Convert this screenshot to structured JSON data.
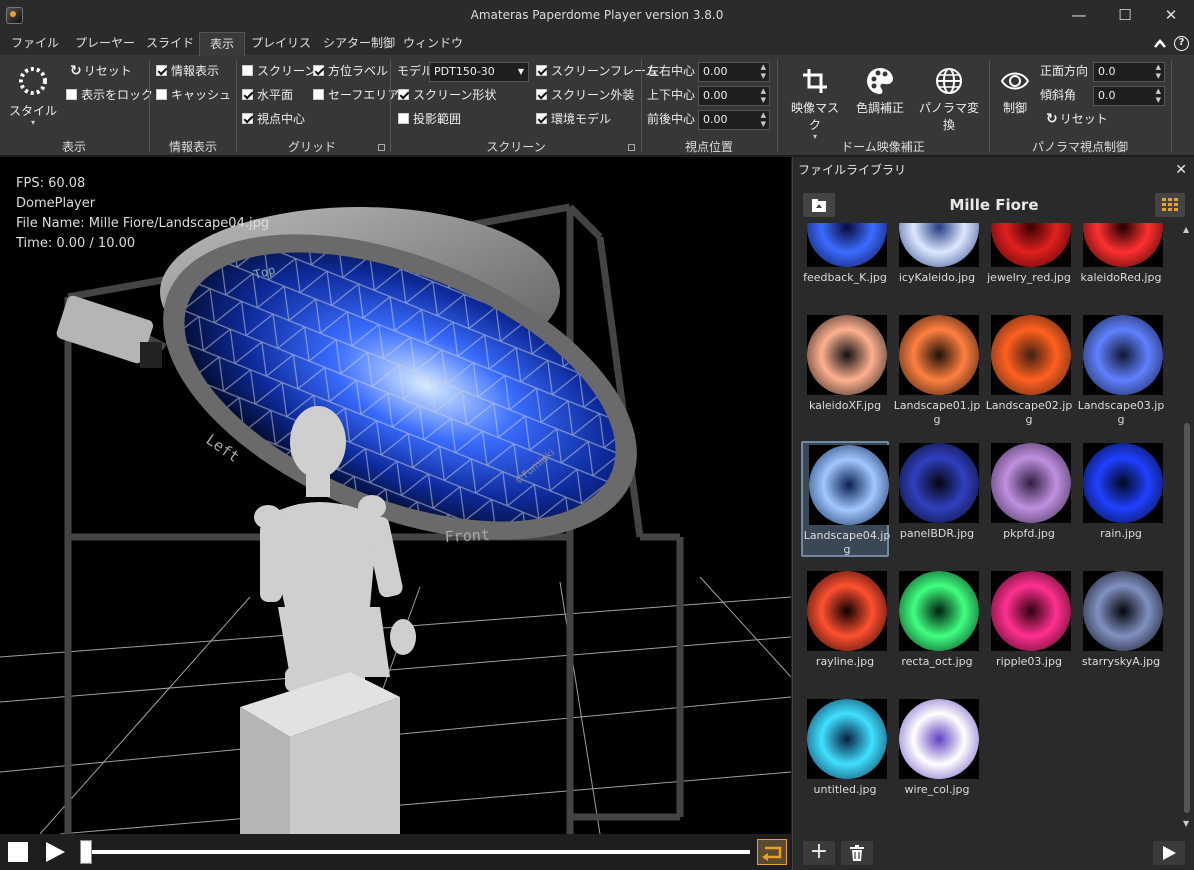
{
  "window": {
    "title": "Amateras Paperdome Player version 3.8.0",
    "minimize": "—",
    "maximize": "☐",
    "close": "✕"
  },
  "menu": {
    "tabs": [
      "ファイル",
      "プレーヤー",
      "スライド",
      "表示",
      "プレイリスト",
      "シアター制御",
      "ウィンドウ"
    ],
    "active": "表示",
    "collapse_icon": "chevron-up-icon",
    "help": "?"
  },
  "ribbon": {
    "display": {
      "style_label": "スタイル",
      "reset": "リセット",
      "lock": "表示をロック",
      "group": "表示"
    },
    "info": {
      "show_info": "情報表示",
      "cache": "キャッシュ",
      "group": "情報表示"
    },
    "grid": {
      "screen": "スクリーン",
      "horizon": "水平面",
      "view_center": "視点中心",
      "azimuth_label": "方位ラベル",
      "safe_area": "セーフエリア",
      "group": "グリッド"
    },
    "screen": {
      "model_label": "モデル",
      "model_value": "PDT150-30",
      "screen_shape": "スクリーン形状",
      "projection_range": "投影範囲",
      "screen_frame": "スクリーンフレーム",
      "screen_exterior": "スクリーン外装",
      "env_model": "環境モデル",
      "group": "スクリーン"
    },
    "viewpoint": {
      "lr_label": "左右中心",
      "lr_value": "0.00",
      "ud_label": "上下中心",
      "ud_value": "0.00",
      "fb_label": "前後中心",
      "fb_value": "0.00",
      "group": "視点位置"
    },
    "dome": {
      "mask": "映像マスク",
      "color": "色調補正",
      "panorama": "パノラマ変換",
      "group": "ドーム映像補正"
    },
    "pano": {
      "control": "制御",
      "front_label": "正面方向",
      "front_value": "0.0",
      "tilt_label": "傾斜角",
      "tilt_value": "0.0",
      "reset": "リセット",
      "group": "パノラマ視点制御"
    }
  },
  "viewport": {
    "fps": "FPS: 60.08",
    "player": "DomePlayer",
    "file": "File Name: Mille Fiore/Landscape04.jpg",
    "time": "Time: 0.00 / 10.00",
    "labels": {
      "left": "Left",
      "front": "Front",
      "top": "Top",
      "watermark": "©Fumiaki"
    }
  },
  "transport": {
    "progress": 0
  },
  "library": {
    "title": "ファイルライブラリ",
    "folder": "Mille Fiore",
    "files": [
      {
        "name": "feedback_K.jpg",
        "c1": "#3b6cff",
        "c2": "#0a0a3a",
        "partial": true
      },
      {
        "name": "icyKaleido.jpg",
        "c1": "#dde8ff",
        "c2": "#223a80",
        "partial": true
      },
      {
        "name": "jewelry_red.jpg",
        "c1": "#e02020",
        "c2": "#3a0000",
        "partial": true
      },
      {
        "name": "kaleidoRed.jpg",
        "c1": "#ff3030",
        "c2": "#200000",
        "partial": true
      },
      {
        "name": "kaleidoXF.jpg",
        "c1": "#ffb090",
        "c2": "#111111"
      },
      {
        "name": "Landscape01.jpg",
        "c1": "#ff8040",
        "c2": "#201008"
      },
      {
        "name": "Landscape02.jpg",
        "c1": "#ff6020",
        "c2": "#402010"
      },
      {
        "name": "Landscape03.jpg",
        "c1": "#6080ff",
        "c2": "#101830"
      },
      {
        "name": "Landscape04.jpg",
        "c1": "#a0c8ff",
        "c2": "#0a2050",
        "selected": true
      },
      {
        "name": "panelBDR.jpg",
        "c1": "#3040c0",
        "c2": "#050510"
      },
      {
        "name": "pkpfd.jpg",
        "c1": "#c090e0",
        "c2": "#302040"
      },
      {
        "name": "rain.jpg",
        "c1": "#2040ff",
        "c2": "#000820"
      },
      {
        "name": "rayline.jpg",
        "c1": "#ff5030",
        "c2": "#100000"
      },
      {
        "name": "recta_oct.jpg",
        "c1": "#40ff80",
        "c2": "#002010"
      },
      {
        "name": "ripple03.jpg",
        "c1": "#ff3090",
        "c2": "#300010"
      },
      {
        "name": "starryskyA.jpg",
        "c1": "#8090c0",
        "c2": "#05050a"
      },
      {
        "name": "untitled.jpg",
        "c1": "#40e0ff",
        "c2": "#082040"
      },
      {
        "name": "wire_col.jpg",
        "c1": "#ffffff",
        "c2": "#6040c0"
      }
    ],
    "add": "+",
    "accent": "#e8a030"
  }
}
